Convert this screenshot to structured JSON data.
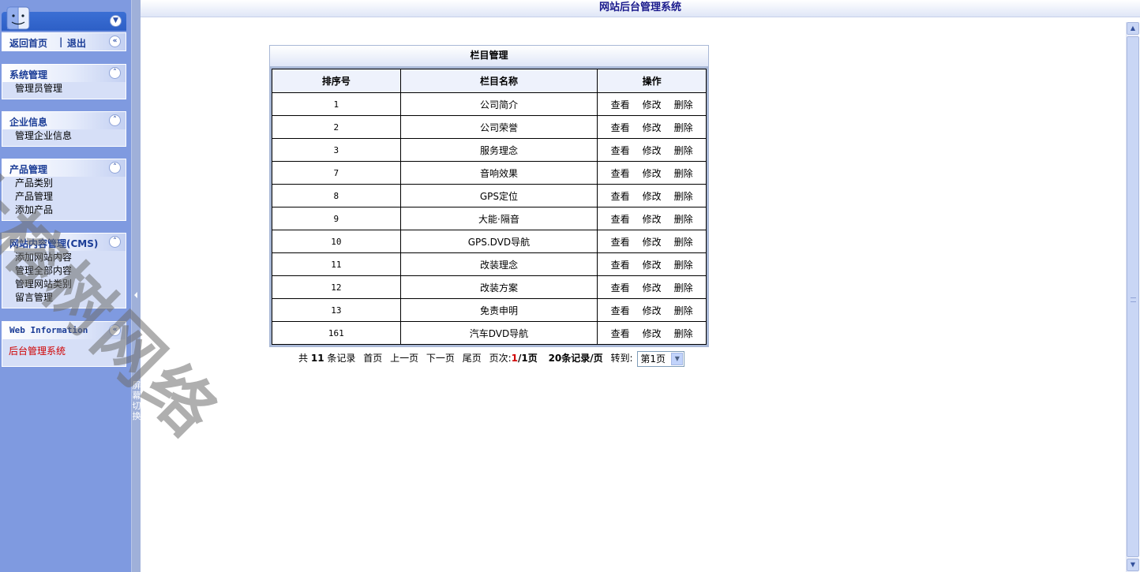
{
  "header": {
    "title": "网站后台管理系统"
  },
  "sidebar": {
    "top_links": {
      "home": "返回首页",
      "separator": "|",
      "logout": "退出"
    },
    "panels": [
      {
        "title": "系统管理",
        "items": [
          "管理员管理"
        ]
      },
      {
        "title": "企业信息",
        "items": [
          "管理企业信息"
        ]
      },
      {
        "title": "产品管理",
        "items": [
          "产品类别",
          "产品管理",
          "添加产品"
        ]
      },
      {
        "title": "网站内容管理(CMS)",
        "items": [
          "添加网站内容",
          "管理全部内容",
          "管理网站类别",
          "留言管理"
        ]
      },
      {
        "title": "Web Information",
        "items": [
          "后台管理系统"
        ]
      }
    ]
  },
  "splitter": {
    "label": "屏幕切换"
  },
  "grid": {
    "title": "栏目管理",
    "columns": [
      "排序号",
      "栏目名称",
      "操作"
    ],
    "actions": [
      "查看",
      "修改",
      "删除"
    ],
    "rows": [
      {
        "order": "1",
        "name": "公司简介"
      },
      {
        "order": "2",
        "name": "公司荣誉"
      },
      {
        "order": "3",
        "name": "服务理念"
      },
      {
        "order": "7",
        "name": "音响效果"
      },
      {
        "order": "8",
        "name": "GPS定位"
      },
      {
        "order": "9",
        "name": "大能·隔音"
      },
      {
        "order": "10",
        "name": "GPS.DVD导航"
      },
      {
        "order": "11",
        "name": "改装理念"
      },
      {
        "order": "12",
        "name": "改装方案"
      },
      {
        "order": "13",
        "name": "免责申明"
      },
      {
        "order": "161",
        "name": "汽车DVD导航"
      }
    ]
  },
  "pager": {
    "prefix": "共",
    "total": "11",
    "suffix": "条记录",
    "first": "首页",
    "prev": "上一页",
    "next": "下一页",
    "last": "尾页",
    "page_label": "页次:",
    "current_page": "1",
    "page_total": "/1页",
    "per_page": "20条记录/页",
    "goto_label": "转到:",
    "goto_value": "第1页"
  },
  "watermark": {
    "text": "大榕树网络"
  }
}
